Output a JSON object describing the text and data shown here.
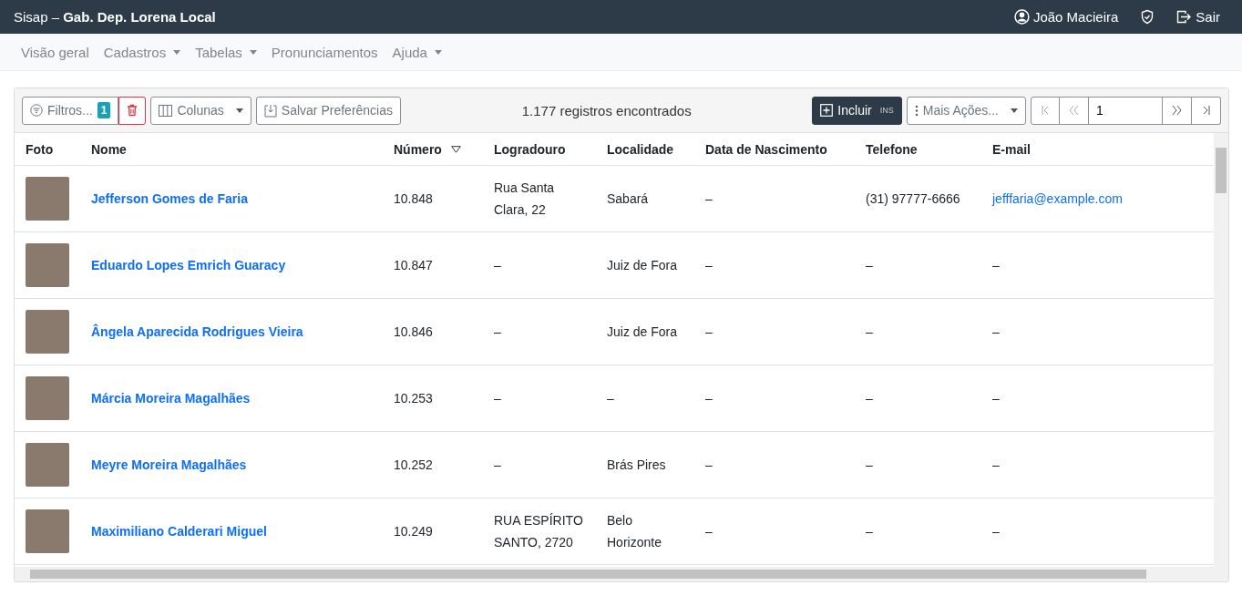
{
  "topbar": {
    "app": "Sisap – ",
    "office": "Gab. Dep. Lorena Local",
    "user": "João Macieira",
    "logout": "Sair"
  },
  "nav": [
    {
      "label": "Visão geral",
      "dropdown": false
    },
    {
      "label": "Cadastros",
      "dropdown": true
    },
    {
      "label": "Tabelas",
      "dropdown": true
    },
    {
      "label": "Pronunciamentos",
      "dropdown": false
    },
    {
      "label": "Ajuda",
      "dropdown": true
    }
  ],
  "toolbar": {
    "filters": "Filtros...",
    "filter_count": "1",
    "columns": "Colunas",
    "save": "Salvar Preferências",
    "count": "1.177 registros encontrados",
    "add": "Incluir",
    "add_shortcut": "INS",
    "more": "Mais Ações...",
    "page": "1"
  },
  "table": {
    "columns": [
      {
        "label": "Foto",
        "sorted": false
      },
      {
        "label": "Nome",
        "sorted": false
      },
      {
        "label": "Número",
        "sorted": true
      },
      {
        "label": "Logradouro",
        "sorted": false
      },
      {
        "label": "Localidade",
        "sorted": false
      },
      {
        "label": "Data de Nascimento",
        "sorted": false
      },
      {
        "label": "Telefone",
        "sorted": false
      },
      {
        "label": "E-mail",
        "sorted": false
      }
    ],
    "rows": [
      {
        "name": "Jefferson Gomes de Faria",
        "number": "10.848",
        "street": "Rua Santa Clara, 22",
        "locality": "Sabará",
        "birth": "–",
        "phone": "(31) 97777-6666",
        "email": "jefffaria@example.com",
        "email_link": true
      },
      {
        "name": "Eduardo Lopes Emrich Guaracy",
        "number": "10.847",
        "street": "–",
        "locality": "Juiz de Fora",
        "birth": "–",
        "phone": "–",
        "email": "–",
        "email_link": false
      },
      {
        "name": "Ângela Aparecida Rodrigues Vieira",
        "number": "10.846",
        "street": "–",
        "locality": "Juiz de Fora",
        "birth": "–",
        "phone": "–",
        "email": "–",
        "email_link": false
      },
      {
        "name": "Márcia Moreira Magalhães",
        "number": "10.253",
        "street": "–",
        "locality": "–",
        "birth": "–",
        "phone": "–",
        "email": "–",
        "email_link": false
      },
      {
        "name": "Meyre Moreira Magalhães",
        "number": "10.252",
        "street": "–",
        "locality": "Brás Pires",
        "birth": "–",
        "phone": "–",
        "email": "–",
        "email_link": false
      },
      {
        "name": "Maximiliano Calderari Miguel",
        "number": "10.249",
        "street": "RUA ESPÍRITO SANTO, 2720",
        "locality": "Belo Horizonte",
        "birth": "–",
        "phone": "–",
        "email": "–",
        "email_link": false
      }
    ]
  }
}
